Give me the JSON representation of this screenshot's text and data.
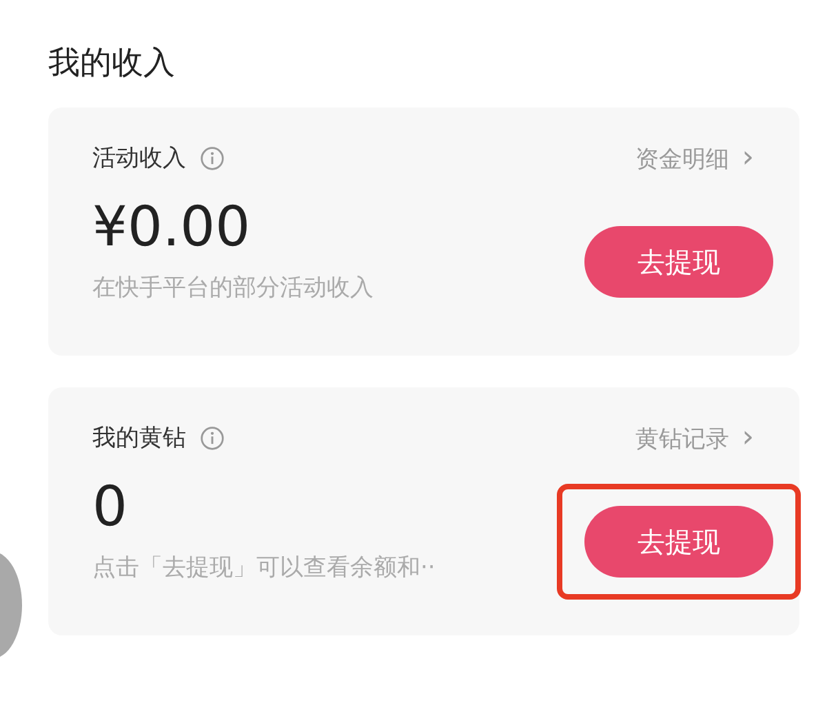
{
  "section_title": "我的收入",
  "cards": [
    {
      "label": "活动收入",
      "link": "资金明细",
      "chevron": "›",
      "amount": "¥0.00",
      "description": "在快手平台的部分活动收入",
      "button": "去提现",
      "highlighted": false
    },
    {
      "label": "我的黄钻",
      "link": "黄钻记录",
      "chevron": "›",
      "amount": "0",
      "description": "点击「去提现」可以查看余额和··",
      "button": "去提现",
      "highlighted": true
    }
  ]
}
